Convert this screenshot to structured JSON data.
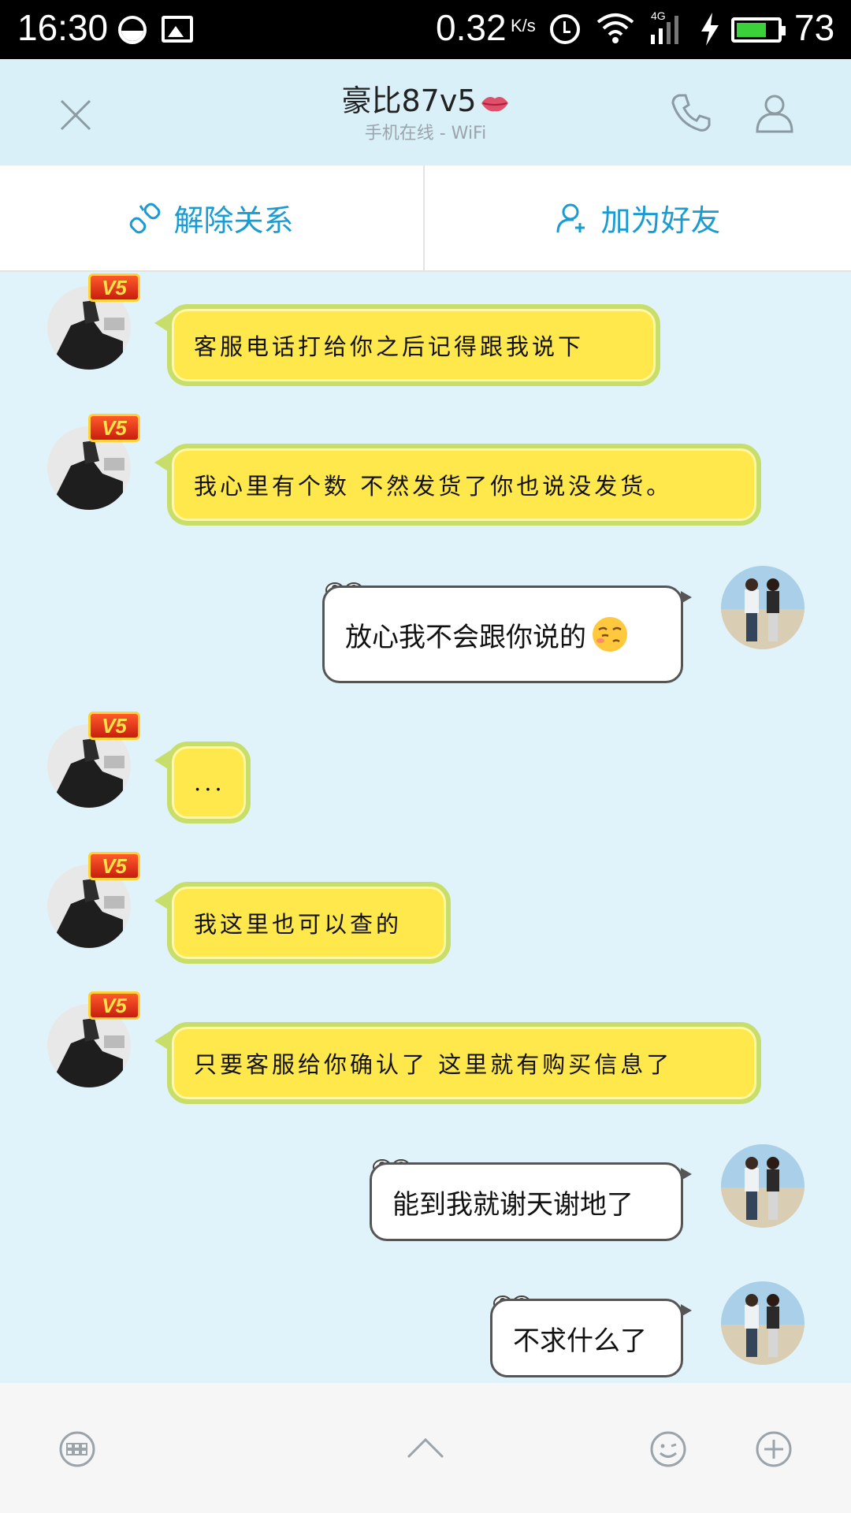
{
  "status_bar": {
    "time": "16:30",
    "net_speed": "0.32",
    "net_unit": "K/s",
    "network_type": "4G",
    "battery_percent": "73",
    "battery_level": 0.73,
    "battery_color": "#3bd13b"
  },
  "header": {
    "title": "豪比87v5",
    "subtitle": "手机在线 - WiFi"
  },
  "actions": {
    "unlink_label": "解除关系",
    "add_friend_label": "加为好友",
    "accent_color": "#1a9bd2"
  },
  "badge": {
    "text": "V5"
  },
  "messages": [
    {
      "side": "left",
      "text": "客服电话打给你之后记得跟我说下"
    },
    {
      "side": "left",
      "text": "我心里有个数 不然发货了你也说没发货。"
    },
    {
      "side": "right",
      "text": "放心我不会跟你说的",
      "emoji": "smirk-emoji"
    },
    {
      "side": "left",
      "text": "..."
    },
    {
      "side": "left",
      "text": "我这里也可以查的"
    },
    {
      "side": "left",
      "text": "只要客服给你确认了 这里就有购买信息了"
    },
    {
      "side": "right",
      "text": "能到我就谢天谢地了"
    },
    {
      "side": "right",
      "text": "不求什么了"
    }
  ],
  "toolbar": {
    "icons": [
      "keyboard-icon",
      "chevron-up-icon",
      "emoji-icon",
      "plus-icon"
    ]
  }
}
